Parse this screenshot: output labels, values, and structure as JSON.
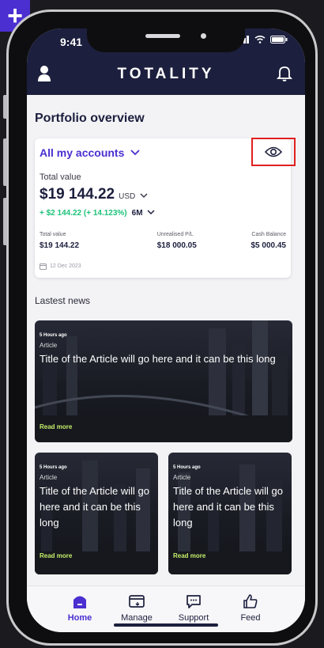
{
  "status_bar": {
    "time": "9:41"
  },
  "header": {
    "brand": "TOTALITY",
    "profile_icon": "profile-icon",
    "bell_icon": "bell-icon"
  },
  "portfolio": {
    "section_title": "Portfolio overview",
    "accounts_label": "All my accounts",
    "total_label": "Total value",
    "total_amount": "$19 144.22",
    "currency": "USD",
    "change_text": "+ $2 144.22 (+ 14.123%)",
    "period": "6M",
    "metrics": [
      {
        "label": "Total value",
        "value": "$19 144.22"
      },
      {
        "label": "Unrealised P/L",
        "value": "$18 000.05"
      },
      {
        "label": "Cash Balance",
        "value": "$5 000.45"
      }
    ],
    "date": "12 Dec 2023"
  },
  "news": {
    "section_title": "Lastest news",
    "articles": [
      {
        "time": "5 Hours ago",
        "category": "Article",
        "title": "Title of the Article will go here and it can be this long",
        "read_more": "Read more"
      },
      {
        "time": "5 Hours ago",
        "category": "Article",
        "title": "Title of the Article will go here and it can be this long",
        "read_more": "Read more"
      },
      {
        "time": "5 Hours ago",
        "category": "Article",
        "title": "Title of the Article will go here and it can be this long",
        "read_more": "Read more"
      }
    ]
  },
  "bottom_nav": {
    "items": [
      {
        "label": "Home",
        "icon": "home-icon",
        "active": true
      },
      {
        "label": "Manage",
        "icon": "wallet-icon",
        "active": false
      },
      {
        "label": "Support",
        "icon": "chat-icon",
        "active": false
      },
      {
        "label": "Feed",
        "icon": "thumbs-up-icon",
        "active": false
      }
    ]
  },
  "colors": {
    "brand": "#1c1f3d",
    "accent": "#4b2fd0",
    "positive": "#1ec27a",
    "highlight": "#e02020"
  }
}
